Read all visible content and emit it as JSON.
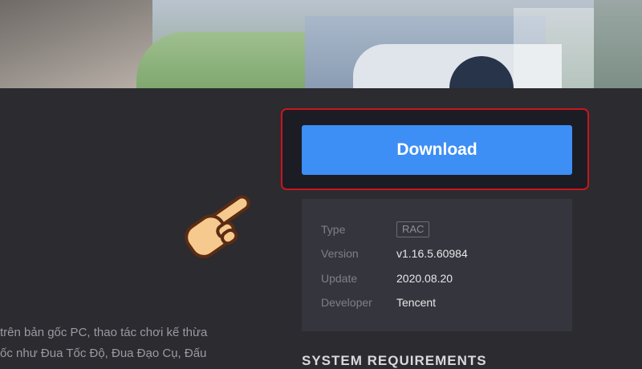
{
  "download": {
    "label": "Download"
  },
  "info": {
    "rows": [
      {
        "key": "Type",
        "value": "RAC"
      },
      {
        "key": "Version",
        "value": "v1.16.5.60984"
      },
      {
        "key": "Update",
        "value": "2020.08.20"
      },
      {
        "key": "Developer",
        "value": "Tencent"
      }
    ]
  },
  "description": {
    "lines": [
      " trên bản gốc PC, thao tác chơi kế thừa",
      "ốc như Đua Tốc Độ, Đua Đạo Cụ, Đấu"
    ]
  },
  "system_requirements": {
    "heading": "SYSTEM REQUIREMENTS"
  },
  "colors": {
    "accent": "#3d8ef5",
    "highlight": "#c8161c",
    "background": "#2b2b30"
  },
  "icons": {
    "pointer": "pointing-hand-icon"
  }
}
